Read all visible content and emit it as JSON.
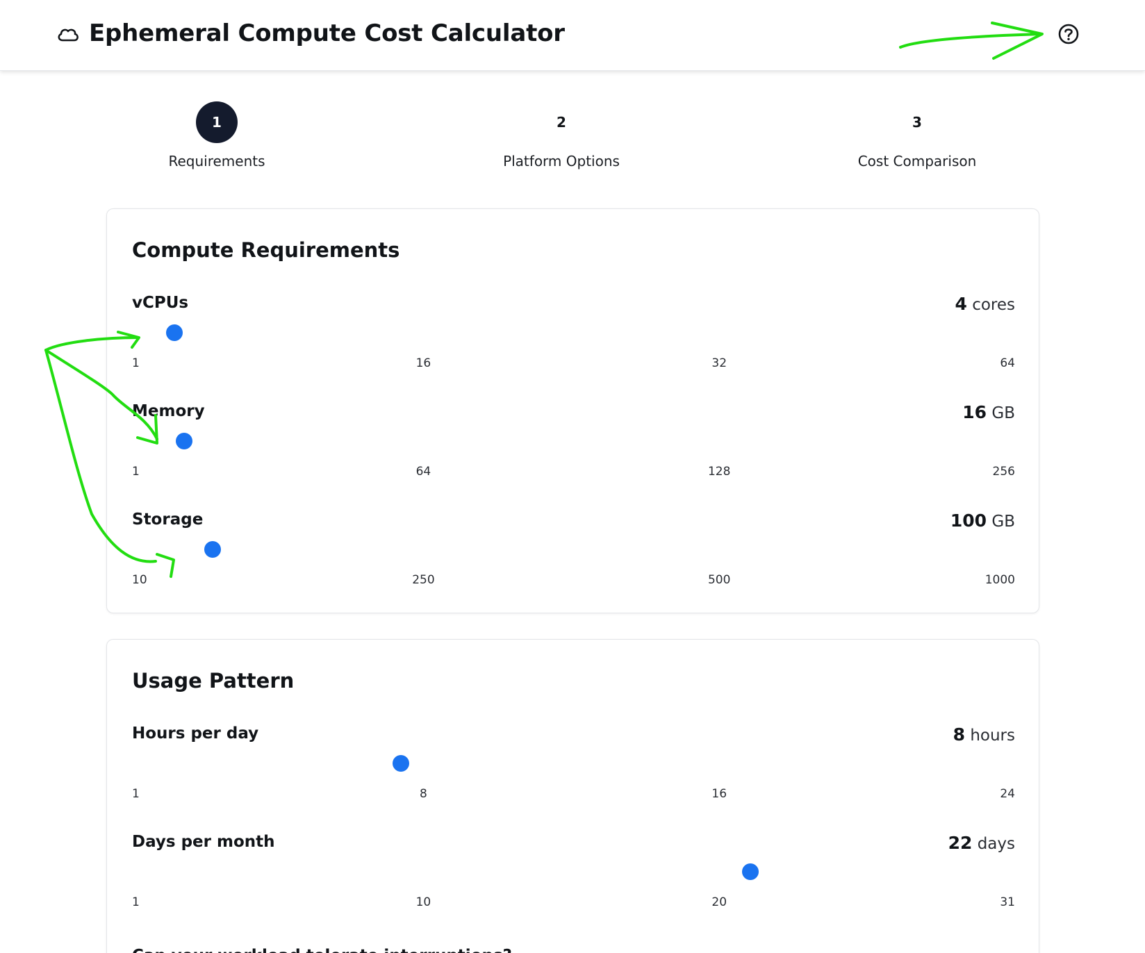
{
  "header": {
    "title": "Ephemeral Compute Cost Calculator",
    "logo_icon": "cloud-icon",
    "help_icon": "help-circle-icon"
  },
  "stepper": {
    "steps": [
      {
        "number": "1",
        "label": "Requirements",
        "active": true
      },
      {
        "number": "2",
        "label": "Platform Options",
        "active": false
      },
      {
        "number": "3",
        "label": "Cost Comparison",
        "active": false
      }
    ]
  },
  "compute": {
    "title": "Compute Requirements",
    "vcpus": {
      "label": "vCPUs",
      "value": "4",
      "unit": "cores",
      "min": 1,
      "max": 64,
      "ticks": [
        "1",
        "16",
        "32",
        "64"
      ]
    },
    "memory": {
      "label": "Memory",
      "value": "16",
      "unit": "GB",
      "min": 1,
      "max": 256,
      "ticks": [
        "1",
        "64",
        "128",
        "256"
      ]
    },
    "storage": {
      "label": "Storage",
      "value": "100",
      "unit": "GB",
      "min": 10,
      "max": 1000,
      "ticks": [
        "10",
        "250",
        "500",
        "1000"
      ]
    }
  },
  "usage": {
    "title": "Usage Pattern",
    "hours": {
      "label": "Hours per day",
      "value": "8",
      "unit": "hours",
      "min": 1,
      "max": 24,
      "ticks": [
        "1",
        "8",
        "16",
        "24"
      ]
    },
    "days": {
      "label": "Days per month",
      "value": "22",
      "unit": "days",
      "min": 1,
      "max": 31,
      "ticks": [
        "1",
        "10",
        "20",
        "31"
      ]
    },
    "interruptions_question": "Can your workload tolerate interruptions?"
  },
  "colors": {
    "accent": "#1a73f0",
    "step_active": "#141b2d",
    "annotation": "#22dd11"
  }
}
